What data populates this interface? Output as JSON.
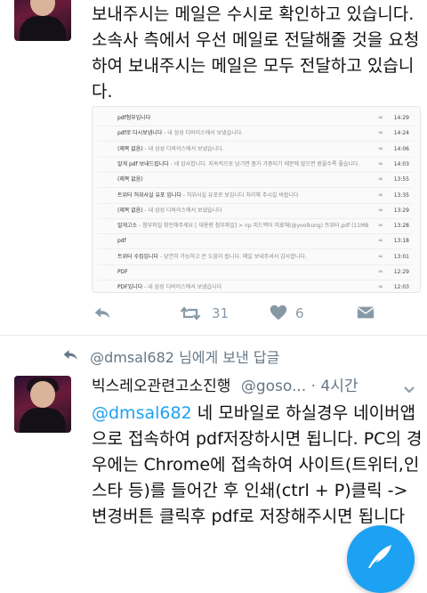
{
  "top_tweet": {
    "text": "보내주시는 메일은 수시로 확인하고 있습니다. 소속사 측에서 우선 메일로 전달해줄 것을 요청하여 보내주시는 메일은 모두 전달하고 있습니다."
  },
  "email_list": [
    {
      "subject": "pdf첨부입니다",
      "snippet": "",
      "time": "14:29"
    },
    {
      "subject": "pdf로 다시보냅니다",
      "snippet": " - 내 삼성 디바이스에서 보냈습니다.",
      "time": "14:24"
    },
    {
      "subject": "(제목 없음)",
      "snippet": " - 내 삼성 디바이스에서 보냈습니다.",
      "time": "14:06"
    },
    {
      "subject": "알게 pdf 보내드립니다",
      "snippet": " - 네 감사합니다. 지속적으로 남기면 좀가 가중되기 때문에 많으면 원을수록 좋습니다.",
      "time": "14:03"
    },
    {
      "subject": "(제목 없음)",
      "snippet": "",
      "time": "13:55"
    },
    {
      "subject": "트위터 허위사실 유포 입니다",
      "snippet": " - 허위사실 유포로 보입니다 처리해 주시길 바랍니다",
      "time": "13:35"
    },
    {
      "subject": "(제목 없음)",
      "snippet": " - 내 삼성 디바이스에서 보냈습니다",
      "time": "13:29"
    },
    {
      "subject": "알게고소",
      "snippet": " - 첨부파일 확인해주세요 [ 대용량 첨부파일] > np  피드백이 피료해(@yoolkung)    트위터.pdf (11MB",
      "time": "13:28"
    },
    {
      "subject": "pdf",
      "snippet": "",
      "time": "13:18"
    },
    {
      "subject": "트위터 수집입니다",
      "snippet": " - 당연히 가능하고 큰 도움이 됩니다. 메일 보내주셔서 감사합니다.",
      "time": "13:01"
    },
    {
      "subject": "PDF",
      "snippet": "",
      "time": "12:29"
    },
    {
      "subject": "PDF입니다",
      "snippet": " - 내 삼성 디바이스에서 보냈습니다",
      "time": "12:03"
    }
  ],
  "actions": {
    "retweet_count": "31",
    "like_count": "6"
  },
  "reply": {
    "context_label": "님에게 보낸 답글",
    "context_handle": "@dmsal682",
    "display_name": "빅스레오관련고소진행",
    "username": "@goso...",
    "time": "· 4시간",
    "mention": "@dmsal682",
    "text": " 네 모바일로 하실경우 네이버앱으로 접속하여  pdf저장하시면 됩니다. PC의 경우에는 Chrome에 접속하여 사이트(트위터,인스타 등)를 들어간 후 인쇄(ctrl + P)클릭 -> 변경버튼 클릭후 pdf로 저장해주시면 됩니다"
  },
  "colors": {
    "accent": "#1da1f2",
    "muted": "#657786",
    "icon": "#8899a6"
  },
  "icons": [
    "reply-icon",
    "retweet-icon",
    "heart-icon",
    "dm-icon",
    "reply-context-icon",
    "chevron-down-icon",
    "compose-icon",
    "attachment-icon"
  ]
}
